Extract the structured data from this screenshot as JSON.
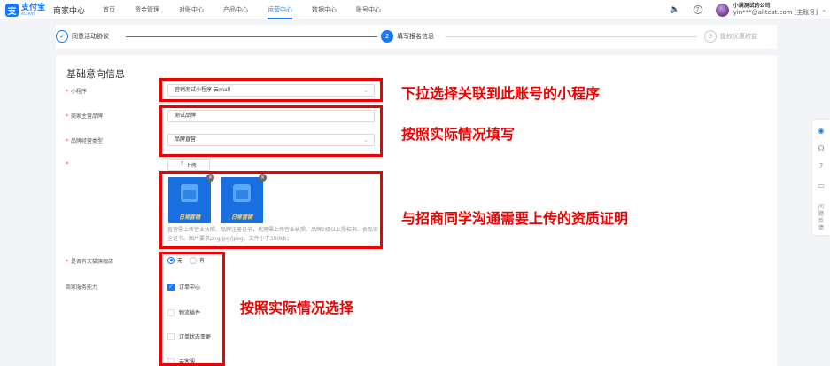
{
  "header": {
    "logo_cn": "支付宝",
    "logo_en": "ALIPAY",
    "app_title": "商家中心",
    "nav": [
      "首页",
      "资金管理",
      "对账中心",
      "产品中心",
      "运营中心",
      "数据中心",
      "账号中心"
    ],
    "active_nav": "运营中心",
    "user_company": "小满测试的公司",
    "user_email": "yin***@alitest.com [主账号]"
  },
  "steps": [
    {
      "label": "同意活动协议",
      "status": "done",
      "marker": "✓"
    },
    {
      "label": "填写报名信息",
      "status": "current",
      "marker": "2"
    },
    {
      "label": "提权优惠权益",
      "status": "pending",
      "marker": "3"
    }
  ],
  "form": {
    "section_title": "基础意向信息",
    "mini_program_label": "小程序",
    "mini_program_value": "营销测试小程序-云mall",
    "brand_label": "商家主营品牌",
    "brand_value": "测试品牌",
    "brand_type_label": "品牌经营类型",
    "brand_type_value": "品牌直营",
    "upload_label": "上传",
    "thumb_label": "日常营销",
    "upload_hint": "直营需上传营业执照、品牌注册证书，代理需上传营业执照、品牌2级以上授权书、食品安全证书。图片要求png/jpg/jpeg，文件小于300kb；",
    "tmall_label": "是否有天猫旗舰店",
    "tmall_options": [
      "无",
      "有"
    ],
    "tmall_selected": "无",
    "service_label": "商家服务能力",
    "services": [
      {
        "label": "订单中心",
        "checked": true
      },
      {
        "label": "物流插件",
        "checked": false
      },
      {
        "label": "订单状态变更",
        "checked": false
      },
      {
        "label": "云客服",
        "checked": false
      }
    ]
  },
  "annotations": {
    "a1": "下拉选择关联到此账号的小程序",
    "a2": "按照实际情况填写",
    "a3": "与招商同学沟通需要上传的资质证明",
    "a4": "按照实际情况选择"
  },
  "side": {
    "feedback": [
      "问",
      "题",
      "反",
      "馈"
    ]
  },
  "colors": {
    "accent": "#1677ff",
    "annotation": "#ee0000"
  }
}
